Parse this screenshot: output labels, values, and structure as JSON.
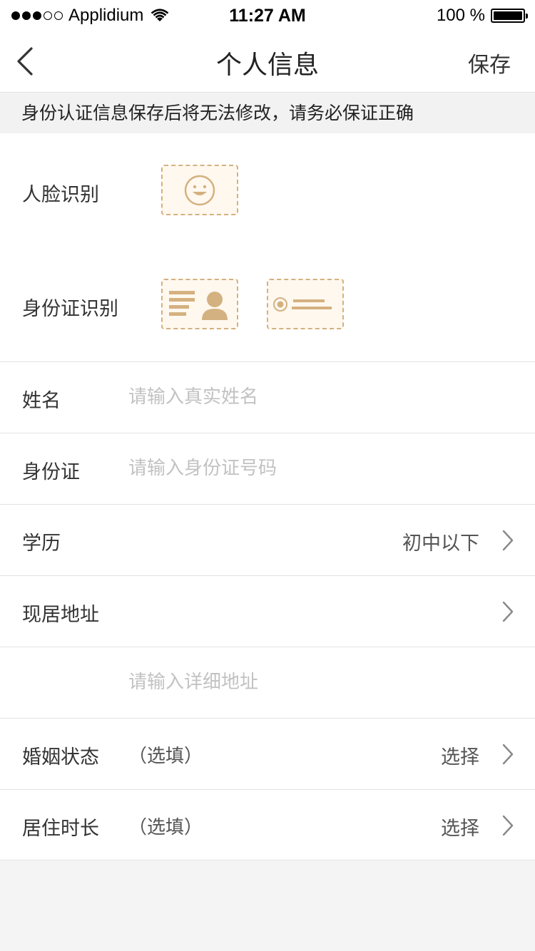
{
  "status_bar": {
    "carrier": "Applidium",
    "time": "11:27 AM",
    "battery": "100 %",
    "signal_icon": "signal-dots-icon",
    "wifi_icon": "wifi-icon",
    "battery_icon": "battery-icon"
  },
  "nav": {
    "back_icon": "chevron-left-icon",
    "title": "个人信息",
    "save_label": "保存"
  },
  "notice": "身份认证信息保存后将无法修改，请务必保证正确",
  "recognition": {
    "face_label": "人脸识别",
    "face_icon": "smiley-face-icon",
    "id_label": "身份证识别",
    "id_front_icon": "id-card-front-icon",
    "id_back_icon": "id-card-back-emblem-icon"
  },
  "form": {
    "name": {
      "label": "姓名",
      "placeholder": "请输入真实姓名"
    },
    "id_number": {
      "label": "身份证",
      "placeholder": "请输入身份证号码"
    },
    "education": {
      "label": "学历",
      "value": "初中以下"
    },
    "address": {
      "label": "现居地址"
    },
    "address_detail": {
      "placeholder": "请输入详细地址"
    },
    "marital": {
      "label": "婚姻状态",
      "optional": "（选填）",
      "value": "选择"
    },
    "residence": {
      "label": "居住时长",
      "optional": "（选填）",
      "value": "选择"
    }
  },
  "colors": {
    "accent": "#d4b180",
    "accent_fill": "#fff8ef",
    "placeholder": "#c2c2c2",
    "divider": "#e3e3e3",
    "background": "#f4f4f4"
  }
}
